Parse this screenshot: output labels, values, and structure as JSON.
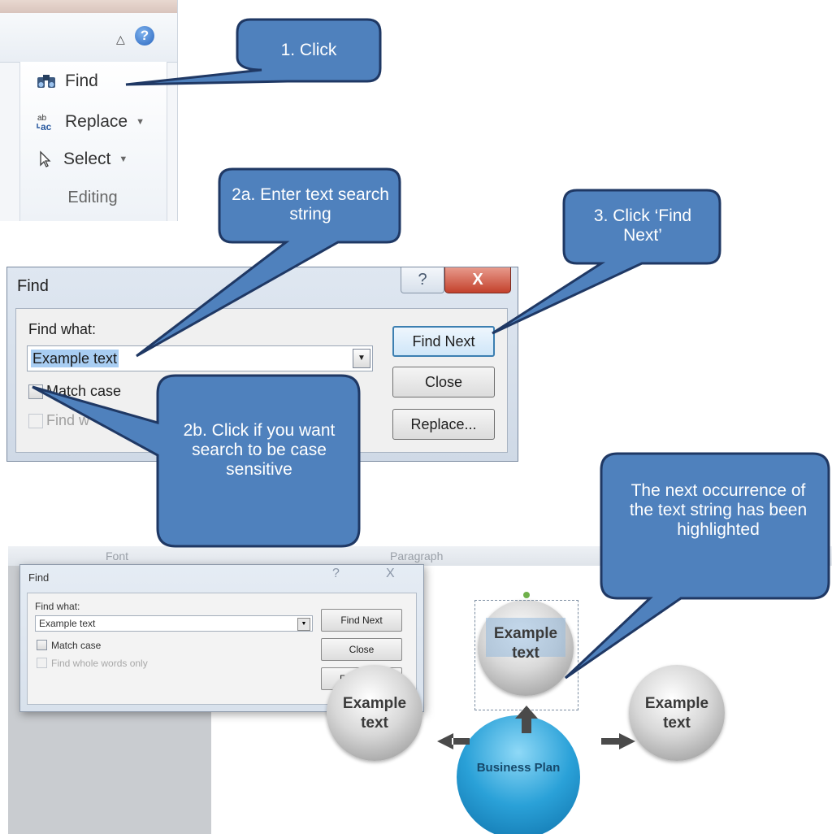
{
  "ribbon": {
    "find_label": "Find",
    "replace_label": "Replace",
    "select_label": "Select",
    "group_label": "Editing",
    "replace_icon_text": "ab\nac"
  },
  "dialog": {
    "title": "Find",
    "help_glyph": "?",
    "close_glyph": "X",
    "find_what_label": "Find what:",
    "find_what_value": "Example text",
    "match_case_label": "Match case",
    "whole_words_label_partial": "Find w",
    "find_next_label": "Find Next",
    "close_label": "Close",
    "replace_label": "Replace..."
  },
  "bottom_screenshot": {
    "ribbon_labels": [
      "Font",
      "Paragraph"
    ],
    "dialog": {
      "title": "Find",
      "help_glyph": "?",
      "close_glyph": "X",
      "find_what_label": "Find what:",
      "find_what_value": "Example text",
      "match_case_label": "Match case",
      "whole_words_label": "Find whole words only",
      "find_next_label": "Find Next",
      "close_label": "Close",
      "replace_label": "Replace..."
    },
    "diagram": {
      "top_ball": "Example text",
      "left_ball": "Example text",
      "right_ball": "Example text",
      "center": "Business Plan"
    }
  },
  "callouts": {
    "c1": "1. Click",
    "c2a": "2a. Enter text search string",
    "c3": "3. Click ‘Find Next’",
    "c2b": "2b. Click if you want search to be case sensitive",
    "c4": "The next occurrence of the text string has been highlighted"
  },
  "colors": {
    "callout_fill": "#4f81bd",
    "callout_border": "#1f3864",
    "selection_highlight": "#a8cdf2",
    "close_button": "#c3412c"
  }
}
